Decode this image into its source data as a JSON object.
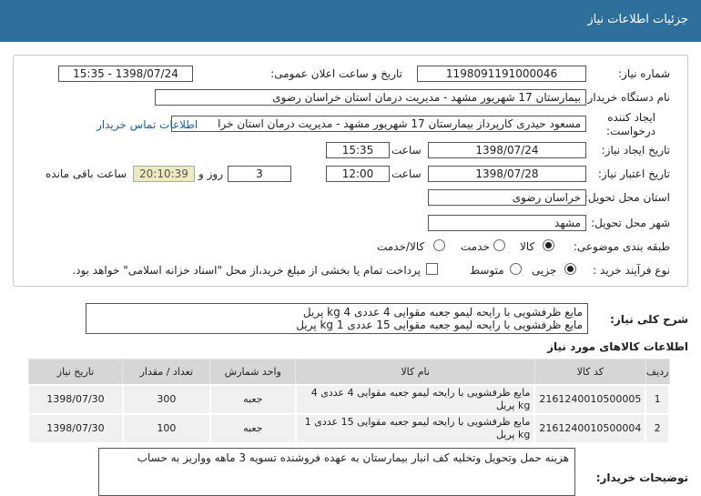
{
  "header": {
    "title": "جزئیات اطلاعات نیاز"
  },
  "fields": {
    "need_number_label": "شماره نیاز:",
    "need_number": "1198091191000046",
    "announce_label": "تاریخ و ساعت اعلان عمومی:",
    "announce_value": "1398/07/24 - 15:35",
    "buyer_org_label": "نام دستگاه خریدار:",
    "buyer_org": "بیمارستان 17 شهریور مشهد - مدیریت درمان استان خراسان رضوی",
    "creator_label_1": "ایجاد کننده",
    "creator_label_2": "درخواست:",
    "creator": "مسعود حیدری کارپرداز بیمارستان 17 شهریور مشهد - مدیریت درمان استان خرا",
    "contact_link": "اطلاعات تماس خریدار",
    "create_date_label": "تاریخ ایجاد نیاز:",
    "create_date": "1398/07/24",
    "time_label": "ساعت",
    "create_time": "15:35",
    "validity_label": "تاریخ اعتبار نیاز:",
    "validity_date": "1398/07/28",
    "validity_time": "12:00",
    "days": "3",
    "days_label": "روز و",
    "countdown": "20:10:39",
    "remaining_label": "ساعت باقی مانده",
    "province_label": "استان محل تحویل:",
    "province": "خراسان رضوی",
    "city_label": "شهر محل تحویل:",
    "city": "مشهد",
    "category_label": "طبقه بندی موضوعی:",
    "category_options": [
      "کالا",
      "خدمت",
      "کالا/خدمت"
    ],
    "category_selected": "کالا",
    "process_label": "نوع فرآیند خرید :",
    "process_options": [
      "جزیی",
      "متوسط"
    ],
    "process_selected": "جزیی",
    "payment_note": "پرداخت تمام یا بخشی از مبلغ خرید،از محل \"اسناد خزانه اسلامی\" خواهد بود."
  },
  "summary": {
    "label": "شرح کلی نیاز:",
    "lines": [
      "مایع ظرفشویی با رایحه لیمو جعبه مقوایی 4 عددی 4 kg پریل",
      "مایع ظرفشویی با رایحه لیمو جعبه مقوایی 15 عددی 1 kg پریل"
    ]
  },
  "items_section": {
    "title": "اطلاعات کالاهای مورد نیاز",
    "columns": [
      "ردیف",
      "کد کالا",
      "نام کالا",
      "واحد شمارش",
      "تعداد / مقدار",
      "تاریخ نیاز"
    ],
    "rows": [
      {
        "row": "1",
        "code": "2161240010500005",
        "name": "مایع ظرفشویی با رایحه لیمو جعبه مقوایی 4 عددی 4 kg پریل",
        "unit": "جعبه",
        "qty": "300",
        "date": "1398/07/30"
      },
      {
        "row": "2",
        "code": "2161240010500004",
        "name": "مایع ظرفشویی با رایحه لیمو جعبه مقوایی 15 عددی 1 kg پریل",
        "unit": "جعبه",
        "qty": "100",
        "date": "1398/07/30"
      }
    ]
  },
  "buyer_notes": {
    "label": "توضیحات خریدار:",
    "text": "هزینه حمل وتحویل وتخلیه کف انبار بیمارستان به عهده فروشنده تسویه 3 ماهه وواریز به حساب"
  }
}
